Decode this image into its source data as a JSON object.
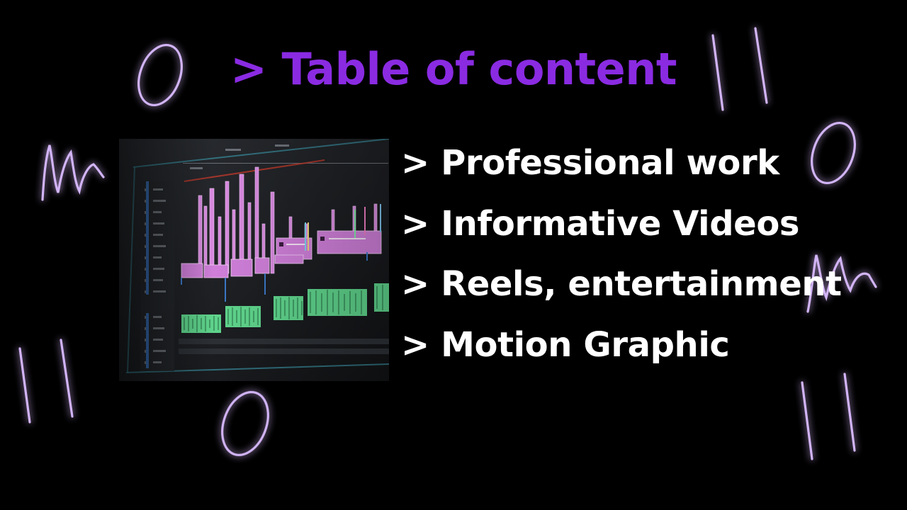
{
  "slide": {
    "title": "> Table of content",
    "items": [
      {
        "label": "> Professional work"
      },
      {
        "label": "> Informative Videos"
      },
      {
        "label": "> Reels, entertainment"
      },
      {
        "label": "> Motion Graphic"
      }
    ],
    "colors": {
      "background": "#000000",
      "title": "#8a2be2",
      "item_text": "#ffffff",
      "doodle": "#c9a8f0",
      "doodle_glow": "#7b2cf0",
      "clip_pink": "#d98ae0",
      "clip_green": "#5fd48c"
    },
    "icons": [
      "video-timeline-photo",
      "neon-doodle-letters"
    ]
  }
}
